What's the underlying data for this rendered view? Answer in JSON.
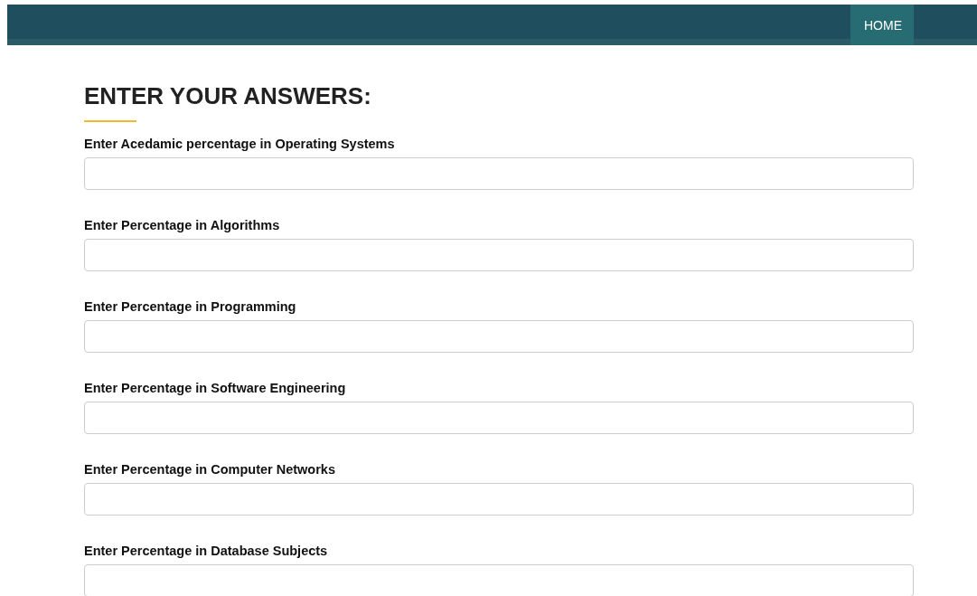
{
  "nav": {
    "items": [
      {
        "label": "HOME",
        "selected": true
      }
    ]
  },
  "title": "ENTER YOUR ANSWERS:",
  "fields": [
    {
      "label": "Enter Acedamic percentage in Operating Systems"
    },
    {
      "label": "Enter Percentage in Algorithms"
    },
    {
      "label": "Enter Percentage in Programming"
    },
    {
      "label": "Enter Percentage in Software Engineering"
    },
    {
      "label": "Enter Percentage in Computer Networks"
    },
    {
      "label": "Enter Percentage in Database Subjects"
    }
  ]
}
